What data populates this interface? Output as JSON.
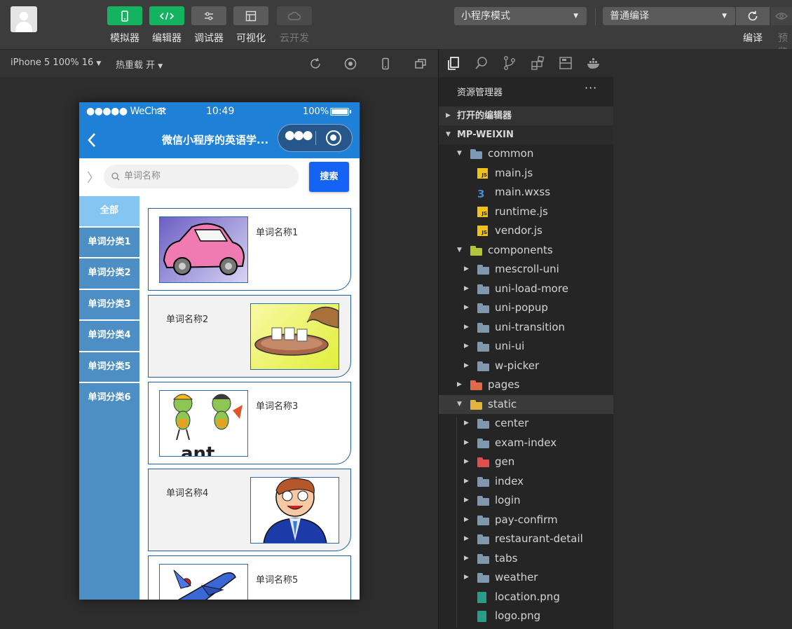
{
  "toolbar": {
    "buttons": [
      {
        "label": "模拟器",
        "icon": "phone-icon"
      },
      {
        "label": "编辑器",
        "icon": "code-icon"
      },
      {
        "label": "调试器",
        "icon": "debug-icon"
      },
      {
        "label": "可视化",
        "icon": "layout-icon"
      },
      {
        "label": "云开发",
        "icon": "cloud-icon"
      }
    ],
    "mode_select": "小程序模式",
    "compile_select": "普通编译",
    "compile_label": "编译",
    "preview_label": "预览"
  },
  "subbar": {
    "device": "iPhone 5 100% 16",
    "hot_reload": "热重载 开"
  },
  "simulator": {
    "status": {
      "carrier": "●●●●● WeChat",
      "time": "10:49",
      "battery": "100%"
    },
    "nav_title": "微信小程序的英语学...",
    "search_placeholder": "单词名称",
    "search_button": "搜索",
    "categories": [
      "全部",
      "单词分类1",
      "单词分类2",
      "单词分类3",
      "单词分类4",
      "单词分类5",
      "单词分类6"
    ],
    "cards": [
      {
        "name": "单词名称1",
        "image": "pink-car"
      },
      {
        "name": "单词名称2",
        "image": "teapot-cups"
      },
      {
        "name": "单词名称3",
        "image": "cartoon-ants"
      },
      {
        "name": "单词名称4",
        "image": "cartoon-businessman"
      },
      {
        "name": "单词名称5",
        "image": "airplane"
      }
    ]
  },
  "explorer": {
    "title": "资源管理器",
    "more": "···",
    "open_editors": "打开的编辑器",
    "project": "MP-WEIXIN",
    "tree": [
      {
        "label": "common",
        "type": "folder-open"
      },
      {
        "label": "main.js",
        "type": "js"
      },
      {
        "label": "main.wxss",
        "type": "wxss"
      },
      {
        "label": "runtime.js",
        "type": "js"
      },
      {
        "label": "vendor.js",
        "type": "js"
      },
      {
        "label": "components",
        "type": "folder-open"
      },
      {
        "label": "mescroll-uni",
        "type": "folder"
      },
      {
        "label": "uni-load-more",
        "type": "folder"
      },
      {
        "label": "uni-popup",
        "type": "folder"
      },
      {
        "label": "uni-transition",
        "type": "folder"
      },
      {
        "label": "uni-ui",
        "type": "folder"
      },
      {
        "label": "w-picker",
        "type": "folder"
      },
      {
        "label": "pages",
        "type": "folder"
      },
      {
        "label": "static",
        "type": "folder-open"
      },
      {
        "label": "center",
        "type": "folder"
      },
      {
        "label": "exam-index",
        "type": "folder"
      },
      {
        "label": "gen",
        "type": "folder"
      },
      {
        "label": "index",
        "type": "folder"
      },
      {
        "label": "login",
        "type": "folder"
      },
      {
        "label": "pay-confirm",
        "type": "folder"
      },
      {
        "label": "restaurant-detail",
        "type": "folder"
      },
      {
        "label": "tabs",
        "type": "folder"
      },
      {
        "label": "weather",
        "type": "folder"
      },
      {
        "label": "location.png",
        "type": "image"
      },
      {
        "label": "logo.png",
        "type": "image"
      }
    ]
  },
  "colors": {
    "toolbar_bg": "#3c3c3c",
    "green_button": "#14b35f",
    "nav_blue": "#1e80d6",
    "search_blue": "#1463f5",
    "category_blue": "#4d8fc4",
    "category_active": "#84c6f1",
    "card_border": "#1e5fa8",
    "explorer_bg": "#252526"
  }
}
